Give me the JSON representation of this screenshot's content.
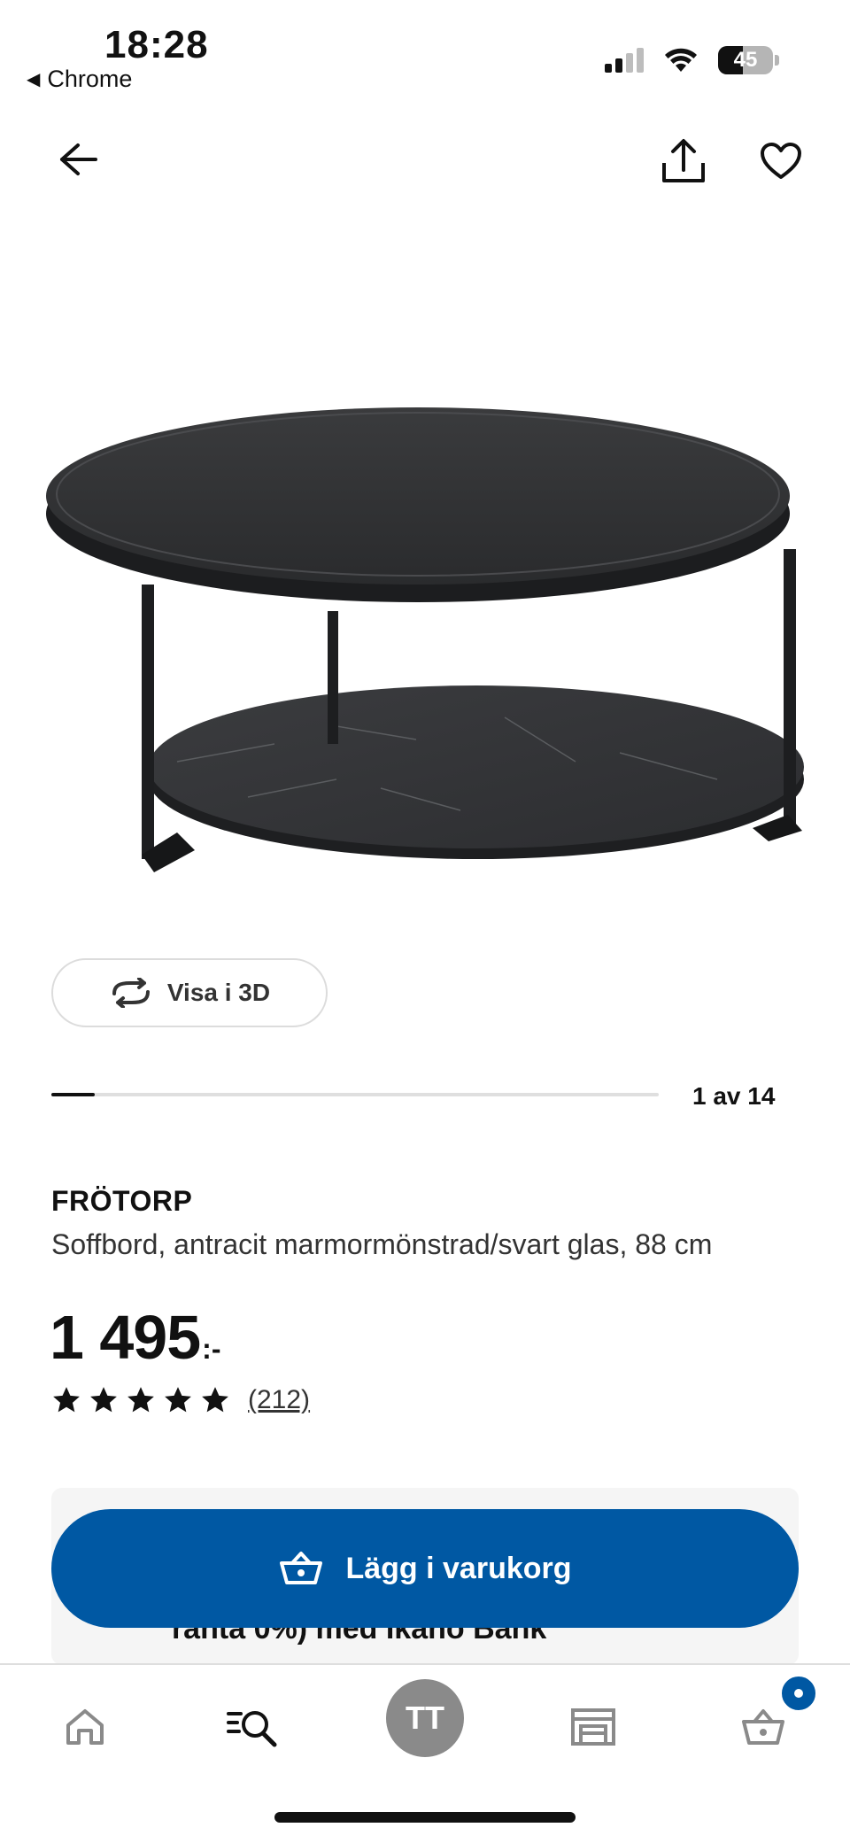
{
  "status_bar": {
    "time": "18:28",
    "back_app": "Chrome",
    "battery": "45",
    "battery_level": 0.45
  },
  "header": {
    "icons": [
      "back-arrow-icon",
      "share-icon",
      "heart-icon"
    ]
  },
  "gallery": {
    "view3d_label": "Visa i 3D",
    "counter": "1 av 14",
    "progress": 0.0714
  },
  "product": {
    "name": "FRÖTORP",
    "description": "Soffbord, antracit marmormönstrad/svart glas, 88 cm",
    "price": "1 495",
    "price_suffix": ":-",
    "rating_stars": 5,
    "review_count": "(212)"
  },
  "finance": {
    "partial_text": "ränta 0%) med Ikano Bank"
  },
  "cart_button": {
    "label": "Lägg i varukorg"
  },
  "bottom_nav": {
    "profile_initials": "TT",
    "items": [
      "home-icon",
      "search-icon",
      "profile-avatar",
      "store-icon",
      "cart-icon"
    ]
  },
  "colors": {
    "brand_blue": "#0058a3",
    "avatar_gray": "#8a8a8a"
  }
}
